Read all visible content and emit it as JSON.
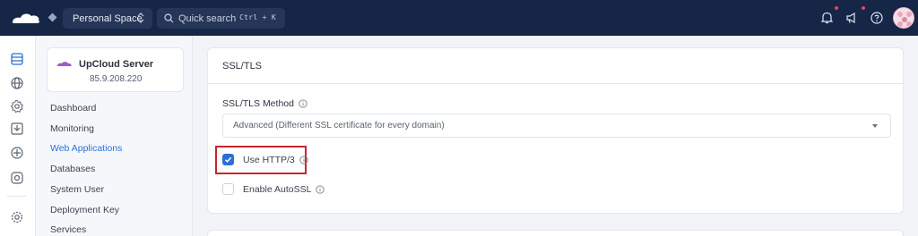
{
  "topbar": {
    "space_label": "Personal Space",
    "search_placeholder": "Quick search",
    "search_shortcut": "Ctrl + K"
  },
  "server": {
    "name": "UpCloud Server",
    "ip": "85.9.208.220"
  },
  "subnav": {
    "items": [
      {
        "label": "Dashboard",
        "active": false
      },
      {
        "label": "Monitoring",
        "active": false
      },
      {
        "label": "Web Applications",
        "active": true
      },
      {
        "label": "Databases",
        "active": false
      },
      {
        "label": "System User",
        "active": false
      },
      {
        "label": "Deployment Key",
        "active": false
      },
      {
        "label": "Services",
        "active": false
      }
    ]
  },
  "main": {
    "section_title": "SSL/TLS",
    "method_label": "SSL/TLS Method",
    "method_value": "Advanced (Different SSL certificate for every domain)",
    "http3_label": "Use HTTP/3",
    "http3_checked": true,
    "autossl_label": "Enable AutoSSL",
    "autossl_checked": false
  },
  "colors": {
    "topbar": "#162647",
    "accent": "#2c6fd6",
    "highlight": "#c8262e",
    "notification_dot": "#e5484d"
  },
  "icons": {
    "topbar": [
      "cloud-logo-icon",
      "chevron-updown-icon",
      "search-icon",
      "bell-icon",
      "megaphone-icon",
      "help-icon"
    ],
    "rail": [
      "servers-icon",
      "globe-icon",
      "settings-gear-icon",
      "backup-icon",
      "network-icon",
      "integrations-icon",
      "preferences-icon"
    ]
  }
}
